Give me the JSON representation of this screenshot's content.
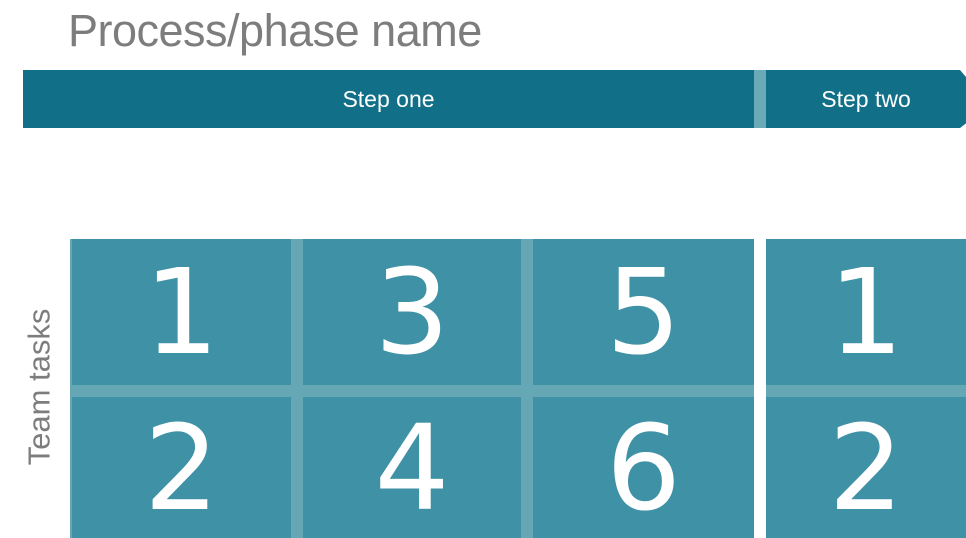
{
  "title": "Process/phase name",
  "steps": [
    {
      "label": "Step one"
    },
    {
      "label": "Step two"
    }
  ],
  "side_label": "Team tasks",
  "step_one_tasks": {
    "row1": [
      "1",
      "3",
      "5"
    ],
    "row2": [
      "2",
      "4",
      "6"
    ]
  },
  "step_two_tasks": {
    "row1": [
      "1"
    ],
    "row2": [
      "2"
    ]
  },
  "colors": {
    "bar": "#117087",
    "cell": "#3f92a6",
    "grid_gap": "#66a7b5",
    "text_gray": "#7d7d7d"
  }
}
